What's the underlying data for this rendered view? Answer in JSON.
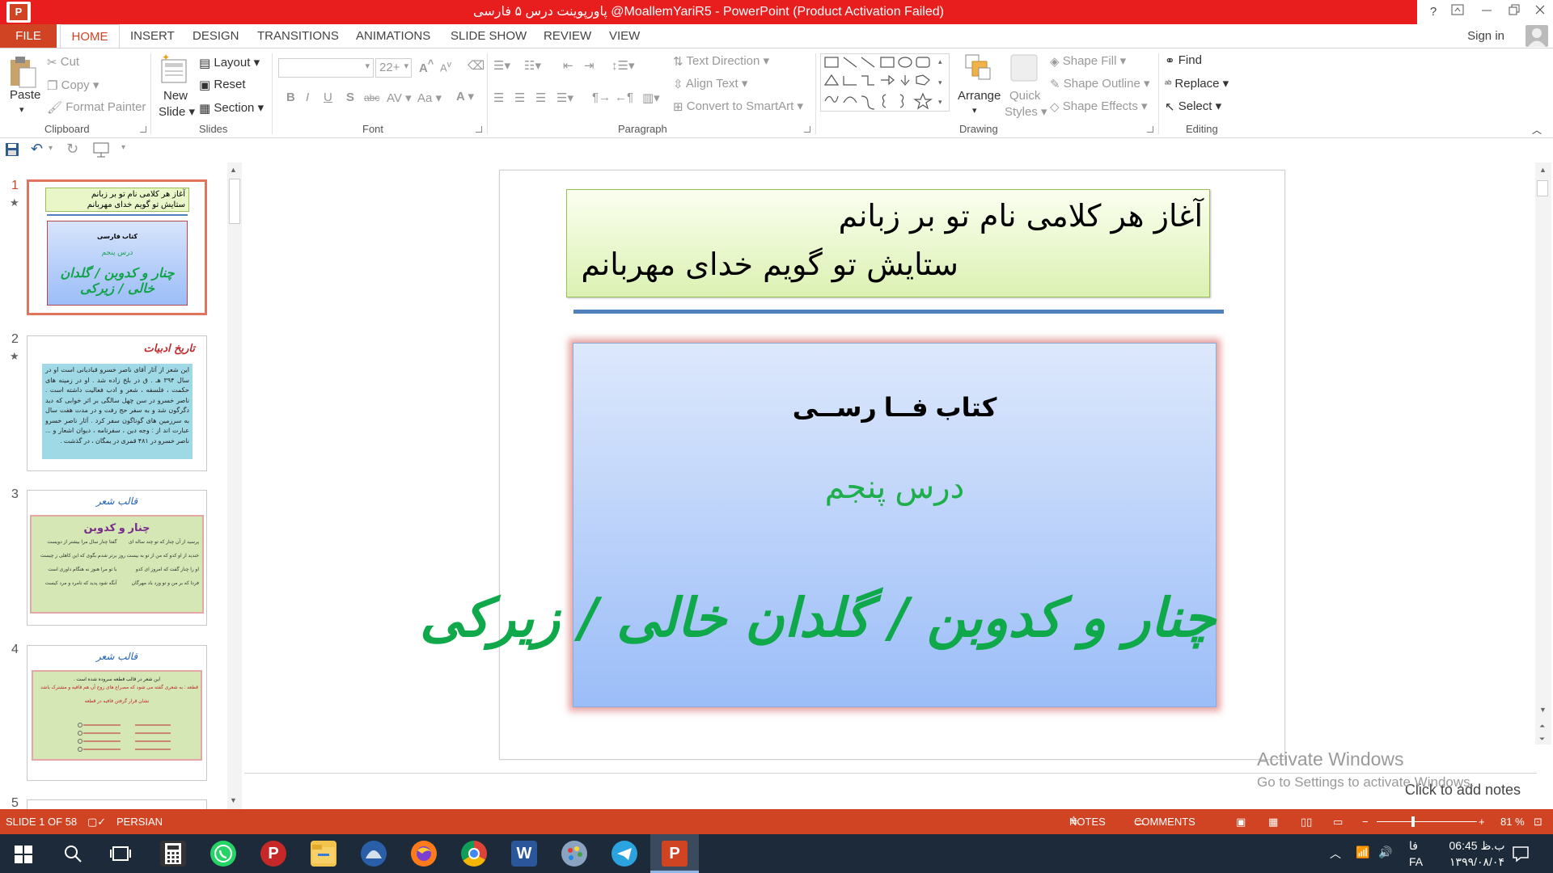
{
  "window": {
    "title": "پاورپوینت درس ۵ فارسی @MoallemYariR5 - PowerPoint (Product Activation Failed)",
    "app_icon": "P",
    "help_label": "?",
    "colors": {
      "accent": "#d04423",
      "titlebar_red": "#e81d1d",
      "taskbar": "#1c2a3a"
    }
  },
  "tabs": [
    "FILE",
    "HOME",
    "INSERT",
    "DESIGN",
    "TRANSITIONS",
    "ANIMATIONS",
    "SLIDE SHOW",
    "REVIEW",
    "VIEW"
  ],
  "signin": "Sign in",
  "ribbon": {
    "clipboard": {
      "label": "Clipboard",
      "paste": "Paste",
      "cut": "Cut",
      "copy": "Copy",
      "format_painter": "Format Painter"
    },
    "slides": {
      "label": "Slides",
      "new_slide_1": "New",
      "new_slide_2": "Slide",
      "layout": "Layout",
      "reset": "Reset",
      "section": "Section"
    },
    "font": {
      "label": "Font",
      "size": "22+",
      "bold": "B",
      "italic": "I",
      "underline": "U",
      "shadow": "S",
      "strike": "abc",
      "spacing": "AV",
      "case": "Aa",
      "color": "A",
      "grow": "A",
      "shrink": "A"
    },
    "paragraph": {
      "label": "Paragraph",
      "text_direction": "Text Direction",
      "align_text": "Align Text",
      "smartart": "Convert to SmartArt"
    },
    "drawing": {
      "label": "Drawing",
      "arrange": "Arrange",
      "quick_styles_1": "Quick",
      "quick_styles_2": "Styles",
      "shape_fill": "Shape Fill",
      "shape_outline": "Shape Outline",
      "shape_effects": "Shape Effects"
    },
    "editing": {
      "label": "Editing",
      "find": "Find",
      "replace": "Replace",
      "select": "Select"
    }
  },
  "thumbnails": [
    {
      "num": "1",
      "star": "★",
      "line1": "آغاز هر کلامی نام تو بر زبانم",
      "line2": "ستایش تو گویم خدای مهربانم",
      "book": "کتاب فارسی",
      "lesson": "درس پنجم",
      "title": "چنار و کدوبن / گلدان خالی / زیرکی"
    },
    {
      "num": "2",
      "star": "★",
      "heading": "تاریخ ادبیات",
      "body": "این شعر از آثار آقای ناصر خسرو قبادیانی است او در سال ۳۹۴ هـ . ق در بلخ زاده شد . او در زمینه های حکمت ، فلسفه ، شعر و ادب فعالیت داشته است . ناصر خسرو در سن چهل سالگی بر اثر خوابی که دید دگرگون شد و به سفر حج رفت و در مدت هفت سال به سرزمین های گوناگون سفر کرد . آثار ناصر خسرو عبارت اند از : وجه دین ، سفرنامه ، دیوان اشعار و ... ناصر خسرو در ۴۸۱ قمری در یمگان ، در گذشت ."
    },
    {
      "num": "3",
      "heading": "قالب شعر",
      "title": "چنار و کدوبن",
      "lines": [
        "پرسید از آن چنار که تو چند ساله ای",
        "گفتا چنار سال مرا بیشتر از دویست",
        "خندید از او کدو که من از تو به بیست روز",
        "برتر شدم بگوی که این کاهلی ز چیست",
        "او را چنار گفت که امروز ای کدو",
        "با تو مرا هنوز نه هنگام داوری است",
        "فردا که بر من و تو وزد باد مهرگان",
        "آنگه شود پدید که نامرد و مرد کیست"
      ]
    },
    {
      "num": "4",
      "heading": "قالب شعر",
      "line1": "این شعر در قالب قطعه سروده شده است .",
      "line2": "قطعه : به شعری گفته می شود که مصراع های زوج آن هم قافیه و مشترک باشد",
      "line3": "نشان قرار گرفتن قافیه در قطعه"
    },
    {
      "num": "5"
    }
  ],
  "slide": {
    "line1": "آغاز هر کلامی نام تو بر زبانم",
    "line2": "ستایش تو گویم خدای مهربانم",
    "book": "کتاب فــا رســی",
    "lesson": "درس پنجم",
    "title": "چنار و کدوبن / گلدان خالی / زیرکی"
  },
  "notes_placeholder": "Click to add notes",
  "watermark": {
    "line1": "Activate Windows",
    "line2": "Go to Settings to activate Windows."
  },
  "status": {
    "slide": "SLIDE 1 OF 58",
    "language": "PERSIAN",
    "notes": "NOTES",
    "comments": "COMMENTS",
    "zoom": "81 %"
  },
  "taskbar": {
    "time": "06:45 ب.ظ",
    "date": "۱۳۹۹/۰۸/۰۴",
    "lang1": "فا",
    "lang2": "FA"
  }
}
